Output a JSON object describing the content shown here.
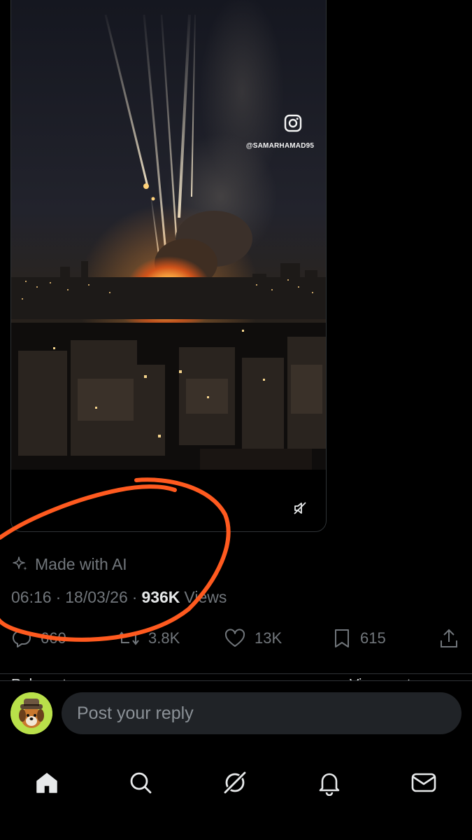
{
  "media": {
    "watermark_handle": "@SAMARHAMAD95",
    "icons": {
      "watermark": "instagram-icon",
      "mute": "speaker-muted-icon"
    }
  },
  "post": {
    "ai_label": "Made with AI",
    "time": "06:16",
    "date": "18/03/26",
    "views_count": "936K",
    "views_label": "Views",
    "separator": "·"
  },
  "actions": {
    "reply": {
      "icon": "reply-icon",
      "count": "660"
    },
    "repost": {
      "icon": "repost-icon",
      "count": "3.8K"
    },
    "like": {
      "icon": "heart-icon",
      "count": "13K"
    },
    "bookmark": {
      "icon": "bookmark-icon",
      "count": "615"
    },
    "share": {
      "icon": "share-icon"
    }
  },
  "peek": {
    "left": "Relevant",
    "right": "View quotes"
  },
  "composer": {
    "placeholder": "Post your reply",
    "avatar_icon": "dog-avatar-icon"
  },
  "nav": [
    {
      "id": "home",
      "icon": "home-icon",
      "active": true
    },
    {
      "id": "search",
      "icon": "search-icon",
      "active": false
    },
    {
      "id": "grok",
      "icon": "grok-icon",
      "active": false
    },
    {
      "id": "notifications",
      "icon": "bell-icon",
      "active": false
    },
    {
      "id": "messages",
      "icon": "mail-icon",
      "active": false
    }
  ],
  "colors": {
    "background": "#000000",
    "secondary_text": "#71767b",
    "primary_text": "#e7e9ea",
    "divider": "#2f3336",
    "annotation": "#ff5a1f",
    "avatar_bg": "#b9e04a"
  }
}
